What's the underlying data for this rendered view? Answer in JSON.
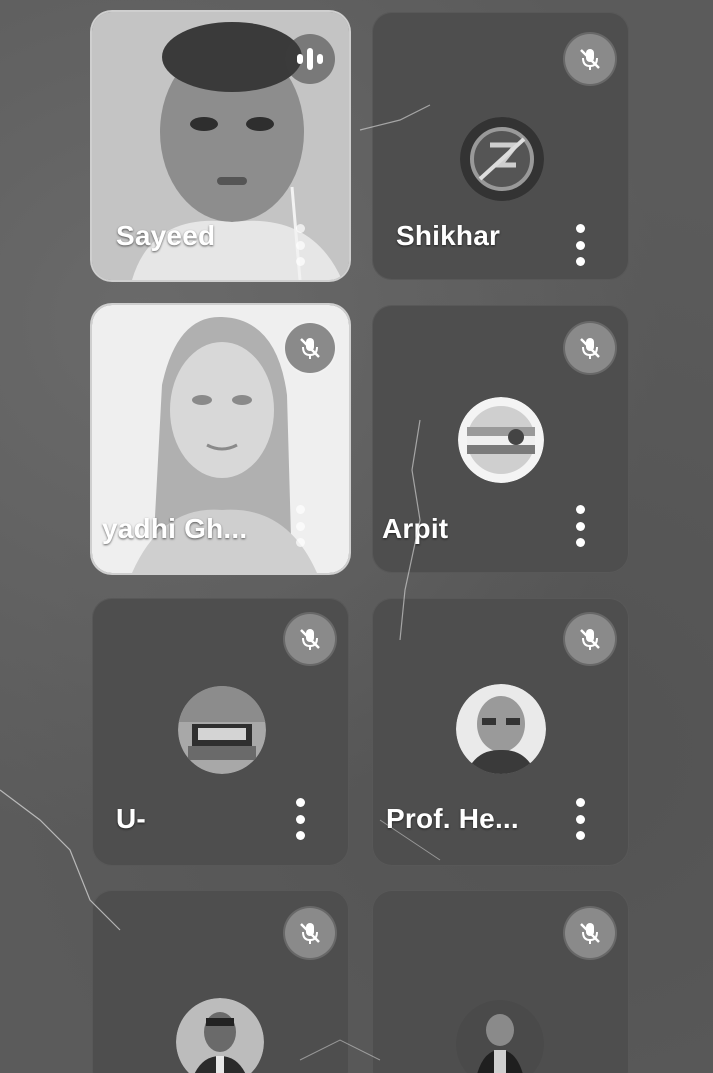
{
  "participants": [
    {
      "name": "Sayeed",
      "state": "speaking",
      "icon": "audio-wave-icon"
    },
    {
      "name": "Shikhar",
      "state": "muted",
      "icon": "mic-off-icon"
    },
    {
      "name": "yadhi Gh...",
      "state": "muted",
      "icon": "mic-off-icon"
    },
    {
      "name": "Arpit",
      "state": "muted",
      "icon": "mic-off-icon"
    },
    {
      "name": "U-",
      "state": "muted",
      "icon": "mic-off-icon"
    },
    {
      "name": "Prof. He...",
      "state": "muted",
      "icon": "mic-off-icon"
    },
    {
      "name": "",
      "state": "muted",
      "icon": "mic-off-icon"
    },
    {
      "name": "",
      "state": "muted",
      "icon": "mic-off-icon"
    }
  ],
  "colors": {
    "tile": "#4e4e4e",
    "mute_badge": "#8a8a8a",
    "text": "#ffffff"
  }
}
